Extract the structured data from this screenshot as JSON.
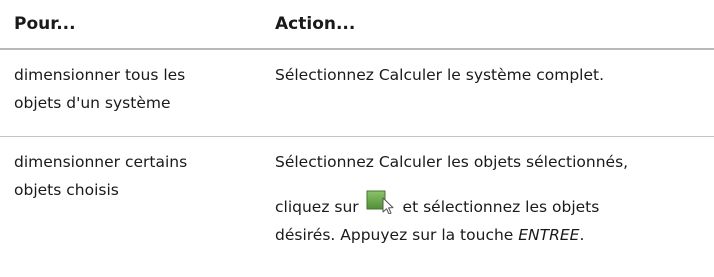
{
  "header": {
    "col1": "Pour...",
    "col2": "Action..."
  },
  "rows": [
    {
      "col1_line1": "dimensionner tous les",
      "col1_line2": "objets d'un système",
      "action": "Sélectionnez Calculer le système complet."
    },
    {
      "col1_line1": "dimensionner certains",
      "col1_line2": "objets choisis",
      "action_line1": "Sélectionnez Calculer les objets sélectionnés,",
      "action_before_icon": "cliquez sur",
      "action_after_icon": "et sélectionnez les objets",
      "action_line3_prefix": "désirés. Appuyez sur la touche",
      "action_key": "ENTREE",
      "action_period": ".",
      "icon": "select-objects-icon"
    }
  ],
  "colors": {
    "header_rule": "#b9b9b9",
    "row_rule": "#c4c4c4",
    "icon_green": "#6aa84f"
  }
}
